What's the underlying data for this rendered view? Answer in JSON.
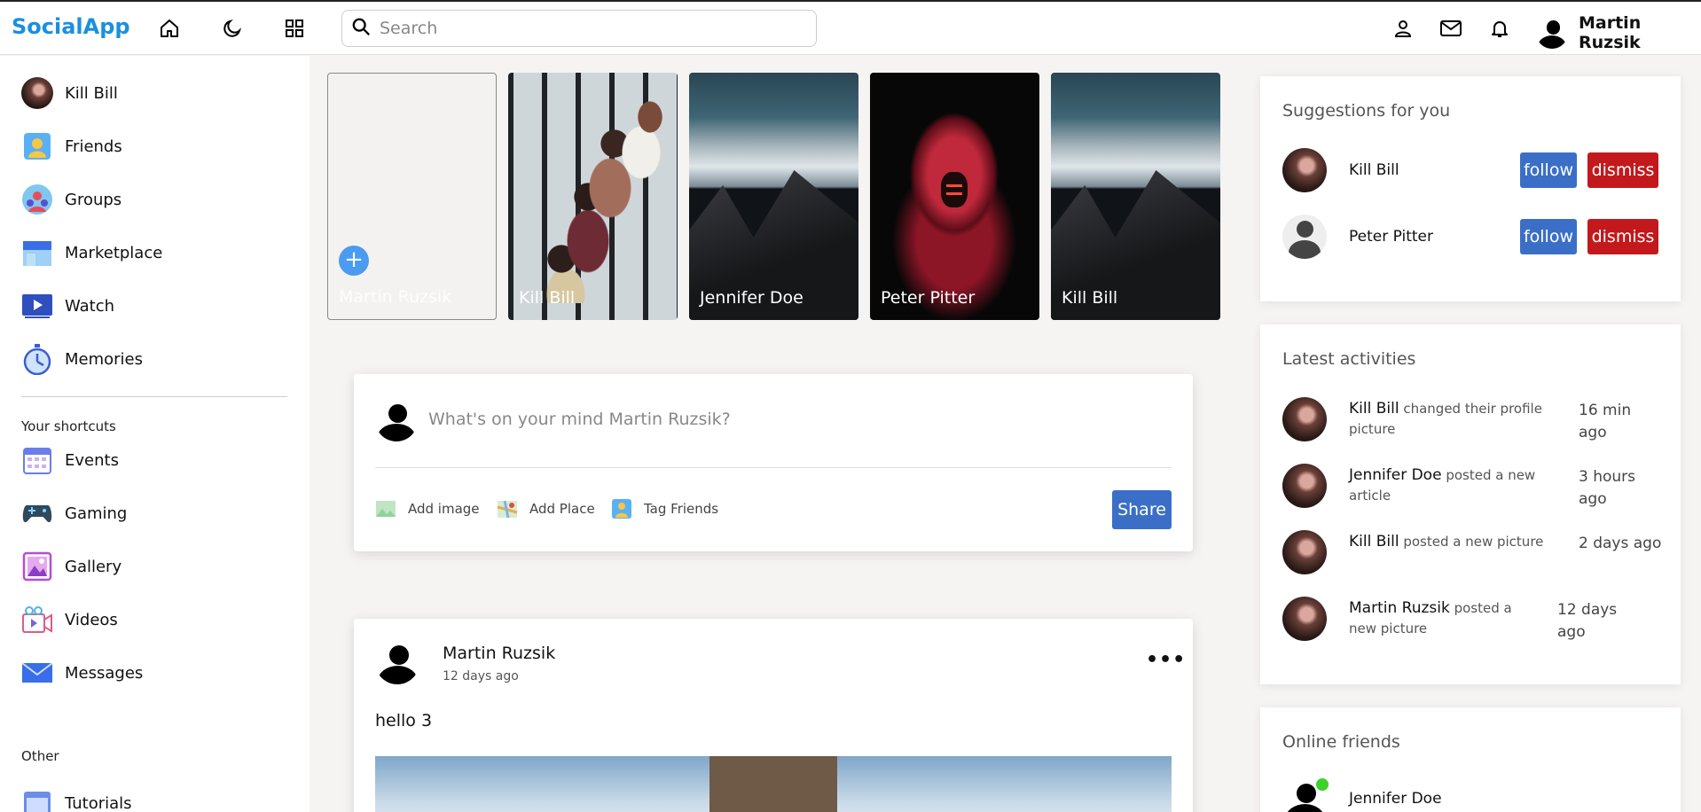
{
  "app": {
    "logo": "SocialApp"
  },
  "nav": {
    "search_placeholder": "Search",
    "user_name": "Martin Ruzsik"
  },
  "leftbar": {
    "items": [
      {
        "label": "Kill Bill",
        "icon": "user-avatar"
      },
      {
        "label": "Friends",
        "icon": "friends-icon"
      },
      {
        "label": "Groups",
        "icon": "groups-icon"
      },
      {
        "label": "Marketplace",
        "icon": "marketplace-icon"
      },
      {
        "label": "Watch",
        "icon": "watch-icon"
      },
      {
        "label": "Memories",
        "icon": "memories-icon"
      }
    ],
    "shortcuts_title": "Your shortcuts",
    "shortcuts": [
      {
        "label": "Events",
        "icon": "events-icon"
      },
      {
        "label": "Gaming",
        "icon": "gaming-icon"
      },
      {
        "label": "Gallery",
        "icon": "gallery-icon"
      },
      {
        "label": "Videos",
        "icon": "videos-icon"
      },
      {
        "label": "Messages",
        "icon": "messages-icon"
      }
    ],
    "other_title": "Other",
    "other": [
      {
        "label": "Tutorials",
        "icon": "tutorials-icon"
      }
    ]
  },
  "stories": [
    {
      "name": "Martin Ruzsik"
    },
    {
      "name": "Kill Bill"
    },
    {
      "name": "Jennifer Doe"
    },
    {
      "name": "Peter Pitter"
    },
    {
      "name": "Kill Bill"
    }
  ],
  "composer": {
    "prompt": "What's on your mind Martin Ruzsik?",
    "add_image": "Add image",
    "add_place": "Add Place",
    "tag_friends": "Tag Friends",
    "share": "Share"
  },
  "post": {
    "author": "Martin Ruzsik",
    "time": "12 days ago",
    "more": "•••",
    "text": "hello 3"
  },
  "suggestions": {
    "title": "Suggestions for you",
    "follow": "follow",
    "dismiss": "dismiss",
    "people": [
      {
        "name": "Kill Bill"
      },
      {
        "name": "Peter Pitter"
      }
    ]
  },
  "activities": {
    "title": "Latest activities",
    "items": [
      {
        "name": "Kill Bill",
        "action": "changed their profile picture",
        "time": "16 min ago"
      },
      {
        "name": "Jennifer Doe",
        "action": "posted a new article",
        "time": "3 hours ago"
      },
      {
        "name": "Kill Bill",
        "action": "posted a new picture",
        "time": "2 days ago"
      },
      {
        "name": "Martin Ruzsik",
        "action": "posted a new picture",
        "time": "12 days ago"
      }
    ]
  },
  "online": {
    "title": "Online friends",
    "friends": [
      {
        "name": "Jennifer Doe"
      }
    ]
  },
  "colors": {
    "brand": "#1b8fe0",
    "primary_button": "#3b6fc7",
    "dismiss_button": "#c3191c",
    "online": "#3cd12a",
    "background": "#f6f3f3"
  }
}
